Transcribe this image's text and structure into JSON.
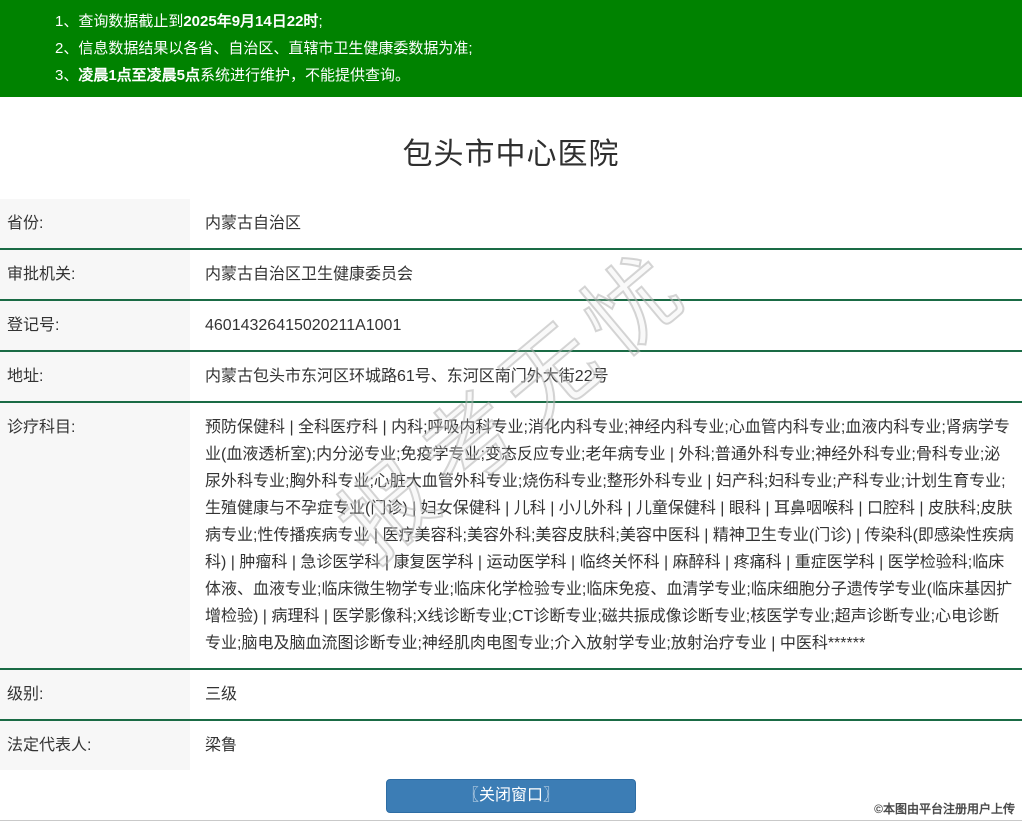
{
  "banner": {
    "bg_color": "#008200",
    "items": [
      {
        "pre": "1、查询数据截止到",
        "bold": "2025年9月14日22时",
        "post": ";"
      },
      {
        "pre": "2、信息数据结果以各省、自治区、直辖市卫生健康委数据为准;",
        "bold": "",
        "post": ""
      },
      {
        "pre": "3、",
        "bold": "凌晨1点至凌晨5点",
        "post": "系统进行维护，不能提供查询。"
      }
    ]
  },
  "page": {
    "title": "包头市中心医院"
  },
  "table": {
    "rows": [
      {
        "label": "省份:",
        "value": "内蒙古自治区"
      },
      {
        "label": "审批机关:",
        "value": "内蒙古自治区卫生健康委员会"
      },
      {
        "label": "登记号:",
        "value": "46014326415020211A1001"
      },
      {
        "label": "地址:",
        "value": "内蒙古包头市东河区环城路61号、东河区南门外大街22号"
      },
      {
        "label": "诊疗科目:",
        "value": "预防保健科 | 全科医疗科 | 内科;呼吸内科专业;消化内科专业;神经内科专业;心血管内科专业;血液内科专业;肾病学专业(血液透析室);内分泌专业;免疫学专业;变态反应专业;老年病专业 | 外科;普通外科专业;神经外科专业;骨科专业;泌尿外科专业;胸外科专业;心脏大血管外科专业;烧伤科专业;整形外科专业 | 妇产科;妇科专业;产科专业;计划生育专业;生殖健康与不孕症专业(门诊) | 妇女保健科 | 儿科 | 小儿外科 | 儿童保健科 | 眼科 | 耳鼻咽喉科 | 口腔科 | 皮肤科;皮肤病专业;性传播疾病专业 | 医疗美容科;美容外科;美容皮肤科;美容中医科 | 精神卫生专业(门诊) | 传染科(即感染性疾病科) | 肿瘤科 | 急诊医学科 | 康复医学科 | 运动医学科 | 临终关怀科 | 麻醉科 | 疼痛科 | 重症医学科 | 医学检验科;临床体液、血液专业;临床微生物学专业;临床化学检验专业;临床免疫、血清学专业;临床细胞分子遗传学专业(临床基因扩增检验) | 病理科 | 医学影像科;X线诊断专业;CT诊断专业;磁共振成像诊断专业;核医学专业;超声诊断专业;心电诊断专业;脑电及脑血流图诊断专业;神经肌肉电图专业;介入放射学专业;放射治疗专业 | 中医科******"
      },
      {
        "label": "级别:",
        "value": "三级"
      },
      {
        "label": "法定代表人:",
        "value": "梁鲁"
      }
    ]
  },
  "footer": {
    "close_button_label": "〖关闭窗口〗",
    "upload_note": "©本图由平台注册用户上传"
  },
  "watermark": {
    "diagonal_text": "报考无忧"
  },
  "colors": {
    "banner_green": "#008200",
    "separator_green": "#1a6b45",
    "label_bg": "#f7f7f7",
    "button_blue": "#3c7db5",
    "text": "#333333"
  }
}
